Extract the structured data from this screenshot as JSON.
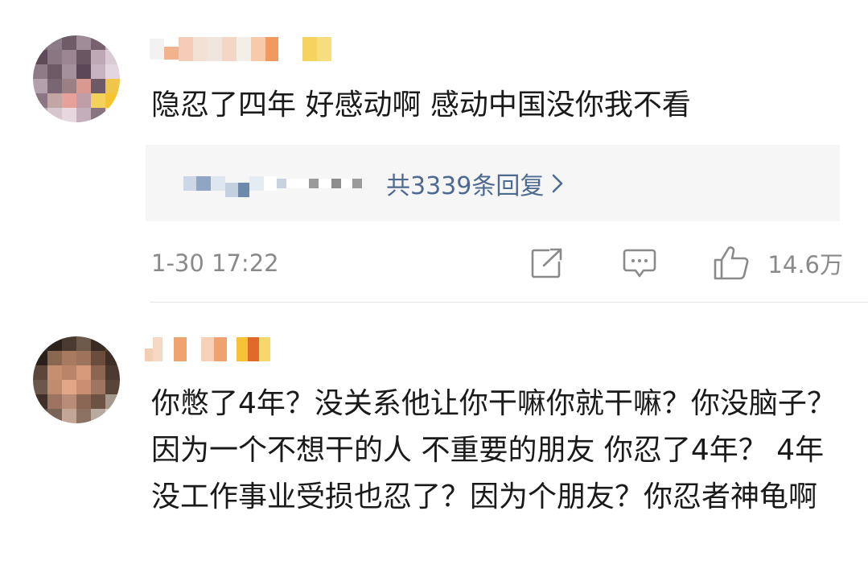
{
  "comments": [
    {
      "text": "隐忍了四年 好感动啊 感动中国没你我不看",
      "replies_label": "共3339条回复",
      "timestamp": "1-30 17:22",
      "likes": "14.6万"
    },
    {
      "text": "你憋了4年？没关系他让你干嘛你就干嘛？你没脑子？因为一个不想干的人 不重要的朋友 你忍了4年？ 4年没工作事业受损也忍了？因为个朋友？你忍者神龟啊"
    }
  ],
  "icons": {
    "share": "share-icon",
    "comment": "comment-icon",
    "like": "thumbs-up-icon",
    "chevron": "chevron-right-icon"
  },
  "colors": {
    "link": "#4e6a92",
    "meta_text": "#8a8a8a",
    "body_text": "#1a1a1a",
    "reply_bg": "#f6f6f6"
  }
}
